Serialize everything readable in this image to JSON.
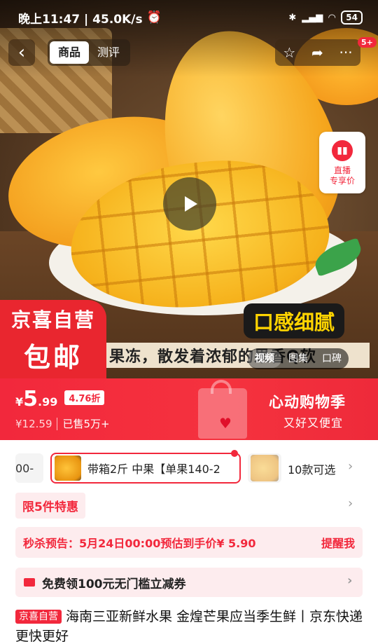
{
  "status_bar": {
    "time": "晚上11:47 | 45.0K/s",
    "battery": "54"
  },
  "nav": {
    "tabs": [
      {
        "label": "商品",
        "active": true
      },
      {
        "label": "测评",
        "active": false
      }
    ],
    "badge": "5+"
  },
  "hero": {
    "live_line1": "直播",
    "live_line2": "专享价",
    "taste_tag": "口感细腻",
    "caption": "果冻，散发着浓郁的果香Q软",
    "media_tabs": [
      "视频",
      "图集",
      "口碑"
    ],
    "promo_line1": "京喜自营",
    "promo_line2": "包邮"
  },
  "price": {
    "currency": "¥",
    "integer": "5",
    "decimal": ".99",
    "discount": "4.76折",
    "original": "¥12.59",
    "sold": "已售5万+",
    "season_title": "心动购物季",
    "season_sub": "又好又便宜"
  },
  "variants": {
    "partial_label": "00-",
    "selected_label": "带箱2斤 中果【单果140-2",
    "count_label": "10款可选"
  },
  "limit_label": "限5件特惠",
  "seckill": {
    "text": "秒杀预告：5月24日00:00预估到手价¥ 5.90",
    "remind": "提醒我"
  },
  "coupon": {
    "text": "免费领100元无门槛立减券"
  },
  "product": {
    "tag": "京喜自营",
    "title": "海南三亚新鲜水果 金煌芒果应当季生鲜丨京东快递 更快更好"
  },
  "colors": {
    "accent": "#f2283c",
    "soft_bg": "#fdecee"
  }
}
